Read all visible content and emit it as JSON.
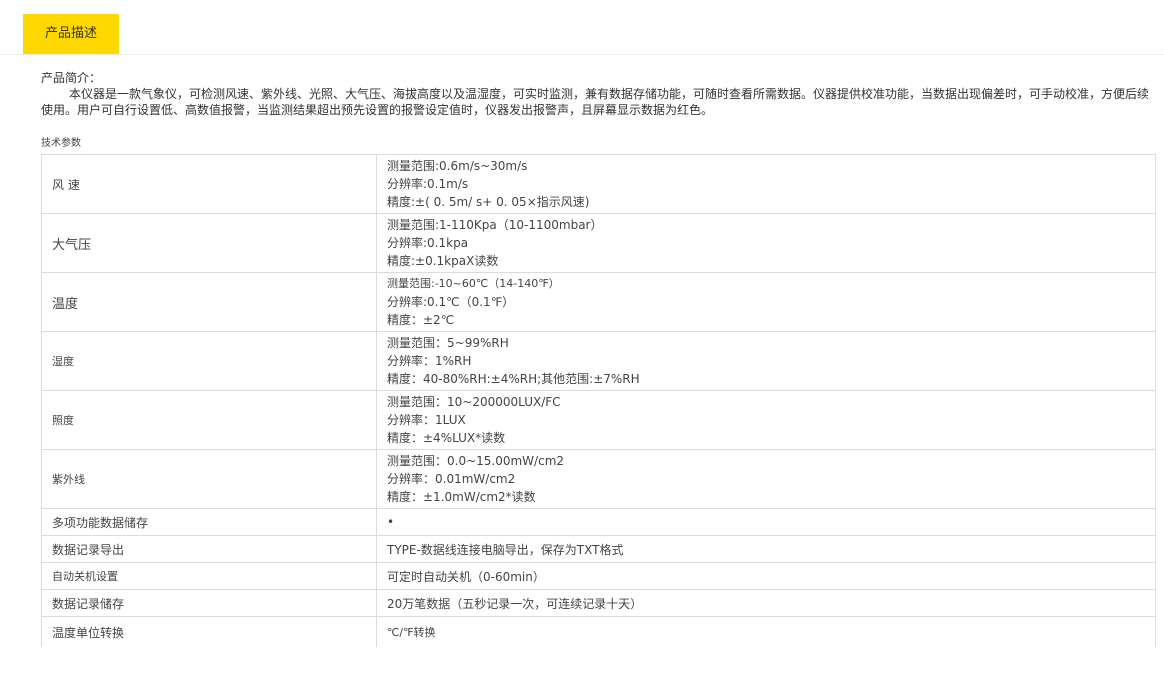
{
  "tab": {
    "label": "产品描述"
  },
  "intro": {
    "heading": "产品简介：",
    "text": "本仪器是一款气象仪，可检测风速、紫外线、光照、大气压、海拔高度以及温湿度，可实时监测，兼有数据存储功能，可随时查看所需数据。仪器提供校准功能，当数据出现偏差时，可手动校准，方便后续使用。用户可自行设置低、高数值报警，当监测结果超出预先设置的报警设定值时，仪器发出报警声，且屏幕显示数据为红色。"
  },
  "params_label": "技术参数",
  "rows": [
    {
      "name": "风 速",
      "lines": [
        "测量范围:0.6m/s~30m/s",
        "分辨率:0.1m/s",
        "精度:±( 0. 5m/ s+ 0. 05×指示风速)"
      ]
    },
    {
      "name": "大气压",
      "lines": [
        "测量范围:1-110Kpa（10-1100mbar）",
        "分辨率:0.1kpa",
        "精度:±0.1kpaX读数"
      ]
    },
    {
      "name": "温度",
      "lines": [
        "测量范围:-10~60℃（14-140℉）",
        "分辨率:0.1℃（0.1℉）",
        "精度：±2℃"
      ]
    },
    {
      "name": "湿度",
      "lines": [
        "测量范围：5~99%RH",
        "分辨率：1%RH",
        "精度：40-80%RH:±4%RH;其他范围:±7%RH"
      ]
    },
    {
      "name": "照度",
      "lines": [
        "测量范围：10~200000LUX/FC",
        "分辨率：1LUX",
        "精度：±4%LUX*读数"
      ]
    },
    {
      "name": "紫外线",
      "lines": [
        "测量范围：0.0~15.00mW/cm2",
        "分辨率：0.01mW/cm2",
        "精度：±1.0mW/cm2*读数"
      ]
    },
    {
      "name": "多项功能数据储存",
      "value": "•"
    },
    {
      "name": "数据记录导出",
      "value": "TYPE-数据线连接电脑导出，保存为TXT格式"
    },
    {
      "name": "自动关机设置",
      "value": "可定时自动关机（0-60min）"
    },
    {
      "name": "数据记录储存",
      "value": "20万笔数据（五秒记录一次，可连续记录十天）"
    },
    {
      "name": "温度单位转换",
      "value": "℃/℉转换"
    }
  ]
}
